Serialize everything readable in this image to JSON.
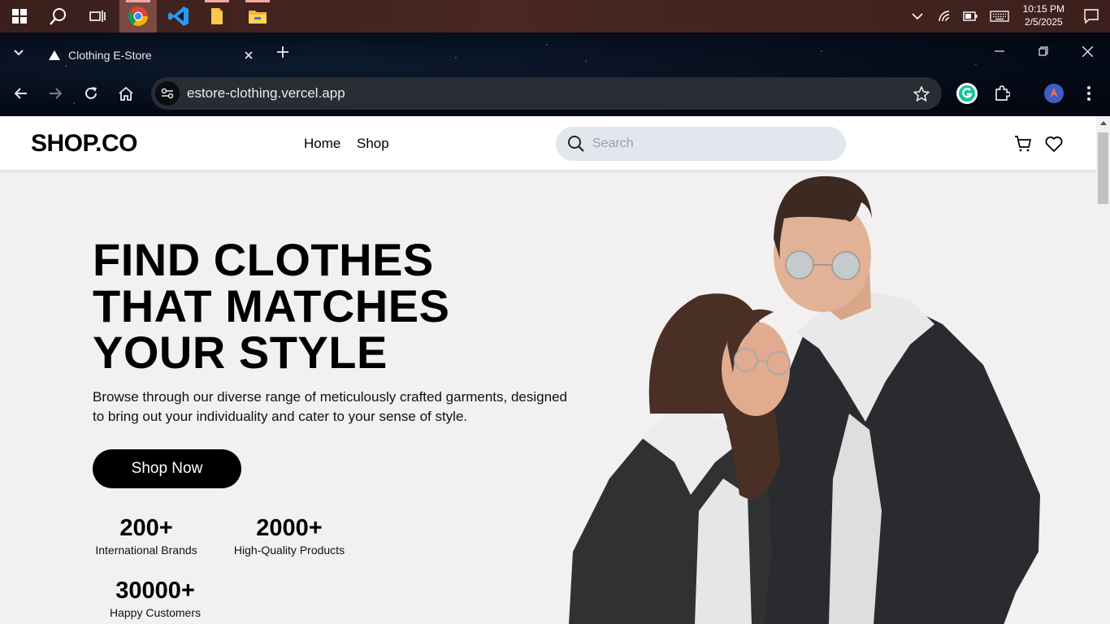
{
  "taskbar": {
    "clock_time": "10:15 PM",
    "clock_date": "2/5/2025",
    "apps": [
      "Chrome",
      "Visual Studio Code",
      "File",
      "File Explorer"
    ]
  },
  "browser": {
    "tab_title": "Clothing E-Store",
    "url": "estore-clothing.vercel.app"
  },
  "site": {
    "logo": "SHOP.CO",
    "nav": {
      "home": "Home",
      "shop": "Shop"
    },
    "search_placeholder": "Search",
    "hero": {
      "title_line1": "FIND CLOTHES",
      "title_line2": "THAT MATCHES",
      "title_line3": "YOUR STYLE",
      "description": "Browse through our diverse range of meticulously crafted garments, designed to bring out your individuality and cater to your sense of style.",
      "cta": "Shop Now"
    },
    "stats": [
      {
        "value": "200+",
        "label": "International Brands"
      },
      {
        "value": "2000+",
        "label": "High-Quality Products"
      },
      {
        "value": "30000+",
        "label": "Happy Customers"
      }
    ]
  },
  "colors": {
    "page_bg": "#f2f0f1",
    "search_bg": "#e3e6ec",
    "cta_bg": "#000000",
    "taskbar_bg": "#3a1f1c",
    "chrome_bg": "#050b18"
  }
}
